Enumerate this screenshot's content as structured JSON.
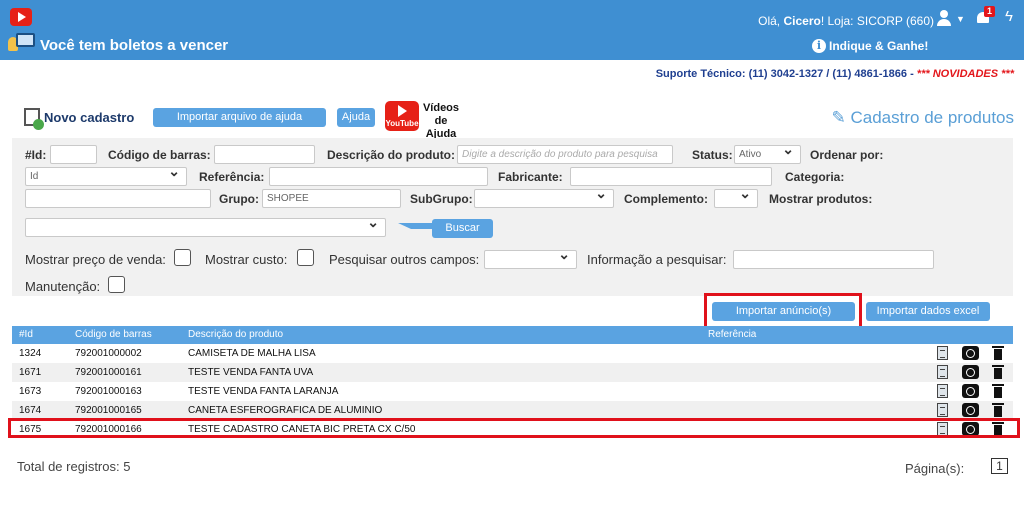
{
  "header": {
    "alert_title": "Você tem boletos a vencer",
    "greeting": "Olá, ",
    "user_name": "Cicero",
    "store_text": "! Loja: SICORP (660)",
    "notification_count": "1",
    "indique": "Indique & Ganhe!"
  },
  "support": {
    "text": "Suporte Técnico: (11) 3042-1327 / (11) 4861-1866 - ",
    "novidades": "*** NOVIDADES ***"
  },
  "toolbar": {
    "novo_cadastro": "Novo cadastro",
    "importar_ajuda": "Importar arquivo de ajuda",
    "ajuda": "Ajuda",
    "videos_line1": "Vídeos",
    "videos_line2": "de Ajuda",
    "youtube": "YouTube",
    "page_title": "Cadastro de produtos"
  },
  "filters": {
    "id_label": "#Id:",
    "id_value": "",
    "barcode_label": "Código de barras:",
    "barcode_value": "",
    "descricao_label": "Descrição do produto:",
    "descricao_placeholder": "Digite a descrição do produto para pesquisa",
    "status_label": "Status:",
    "status_value": "Ativo",
    "ordenar_label": "Ordenar por:",
    "ordenar_value": "Id",
    "referencia_label": "Referência:",
    "fabricante_label": "Fabricante:",
    "categoria_label": "Categoria:",
    "grupo_label": "Grupo:",
    "grupo_value": "SHOPEE",
    "subgrupo_label": "SubGrupo:",
    "complemento_label": "Complemento:",
    "mostrar_produtos_label": "Mostrar produtos:",
    "buscar": "Buscar",
    "mostrar_preco_label": "Mostrar preço de venda:",
    "mostrar_custo_label": "Mostrar custo:",
    "pesquisar_outros_label": "Pesquisar outros campos:",
    "informacao_label": "Informação a pesquisar:",
    "manutencao_label": "Manutenção:"
  },
  "actions": {
    "importar_anuncios": "Importar anúncio(s)",
    "importar_excel": "Importar dados excel"
  },
  "table": {
    "headers": {
      "id": "#Id",
      "barcode": "Código de barras",
      "descricao": "Descrição do produto",
      "referencia": "Referência"
    },
    "rows": [
      {
        "id": "1324",
        "barcode": "792001000002",
        "descricao": "CAMISETA DE MALHA LISA"
      },
      {
        "id": "1671",
        "barcode": "792001000161",
        "descricao": "TESTE VENDA FANTA UVA"
      },
      {
        "id": "1673",
        "barcode": "792001000163",
        "descricao": "TESTE VENDA FANTA LARANJA"
      },
      {
        "id": "1674",
        "barcode": "792001000165",
        "descricao": "CANETA ESFEROGRAFICA DE ALUMINIO"
      },
      {
        "id": "1675",
        "barcode": "792001000166",
        "descricao": "TESTE CADASTRO CANETA BIC PRETA CX C/50"
      }
    ]
  },
  "footer": {
    "total": "Total de registros: 5",
    "paginas": "Página(s):",
    "page": "1"
  }
}
